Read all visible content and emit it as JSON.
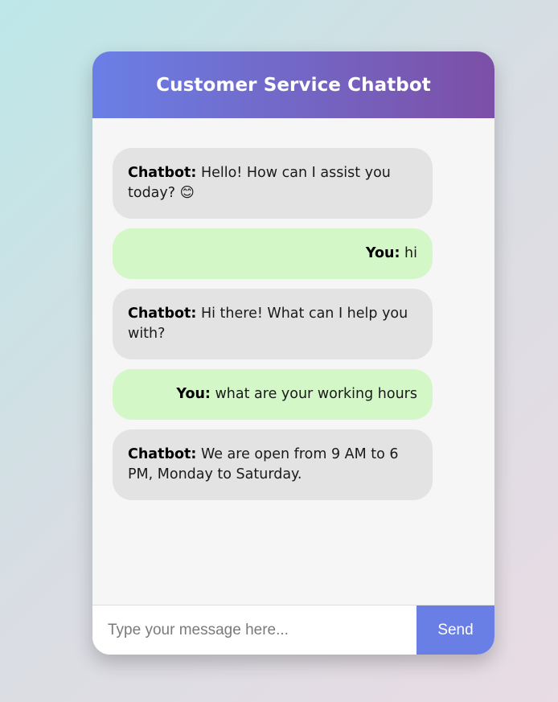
{
  "header": {
    "title": "Customer Service Chatbot"
  },
  "messages": [
    {
      "sender": "bot",
      "label": "Chatbot:",
      "text": " Hello! How can I assist you today? 😊"
    },
    {
      "sender": "user",
      "label": "You:",
      "text": " hi"
    },
    {
      "sender": "bot",
      "label": "Chatbot:",
      "text": " Hi there! What can I help you with?"
    },
    {
      "sender": "user",
      "label": "You:",
      "text": " what are your working hours"
    },
    {
      "sender": "bot",
      "label": "Chatbot:",
      "text": " We are open from 9 AM to 6 PM, Monday to Saturday."
    }
  ],
  "input": {
    "placeholder": "Type your message here...",
    "value": ""
  },
  "send_button": {
    "label": "Send"
  },
  "colors": {
    "header_gradient_start": "#6a7fe6",
    "header_gradient_end": "#7c4fa6",
    "bot_bubble": "#e3e3e3",
    "user_bubble": "#d4f7c7",
    "send_button": "#6a7fe6"
  }
}
